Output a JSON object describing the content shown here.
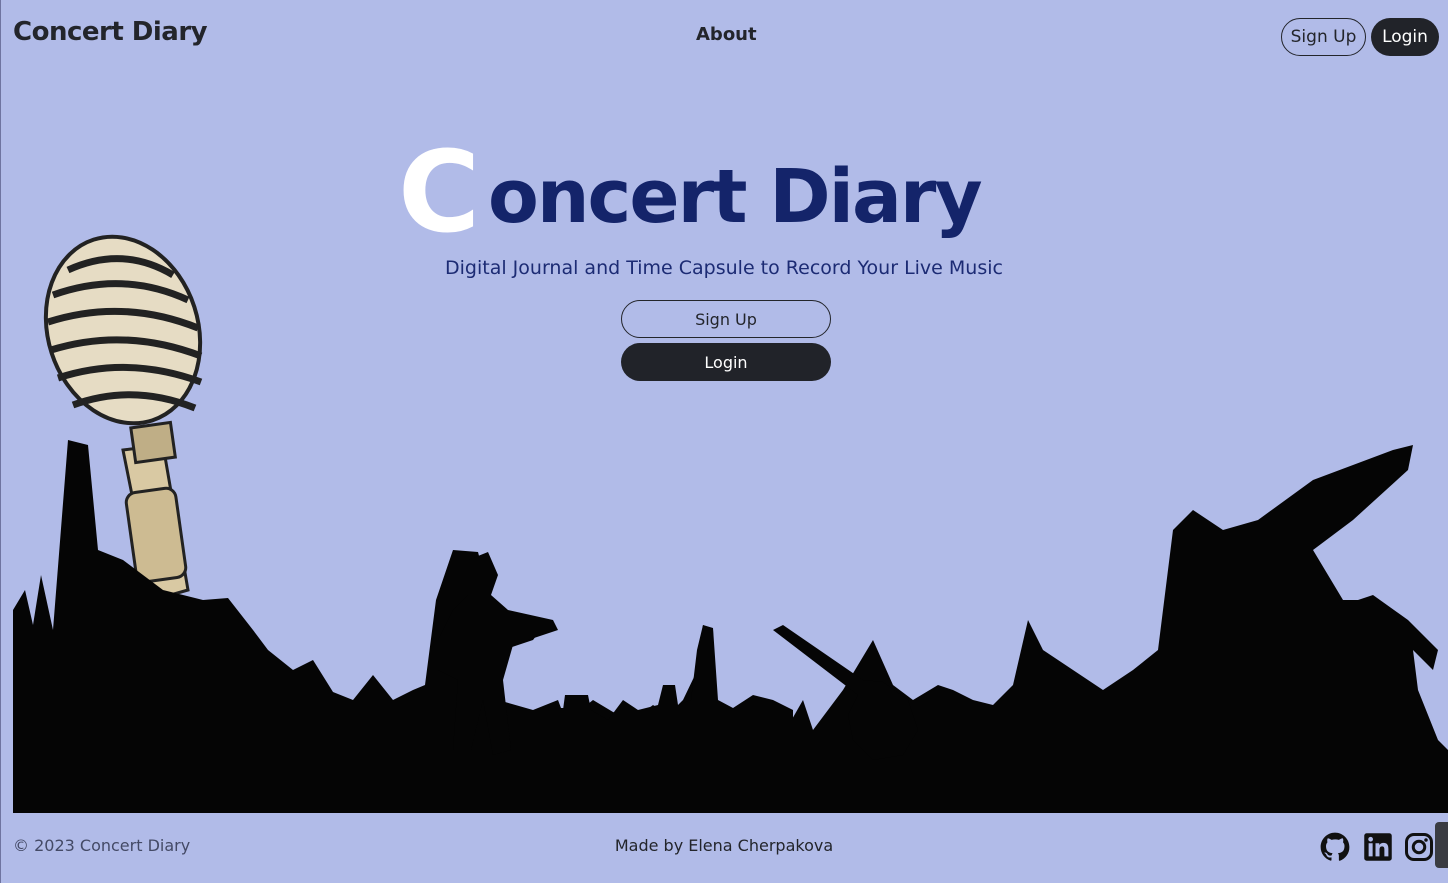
{
  "nav": {
    "brand": "Concert Diary",
    "about": "About",
    "signup": "Sign Up",
    "login": "Login"
  },
  "hero": {
    "title_initial": "C",
    "title_rest": "oncert Diary",
    "tagline": "Digital Journal and Time Capsule to Record Your Live Music",
    "signup": "Sign Up",
    "login": "Login"
  },
  "footer": {
    "copyright": "© 2023 Concert Diary",
    "credit": "Made by Elena Cherpakova",
    "social_icons": [
      "github-icon",
      "linkedin-icon",
      "instagram-icon"
    ]
  },
  "colors": {
    "background": "#b1bbe8",
    "title": "#14246a",
    "dark_button": "#212329"
  }
}
